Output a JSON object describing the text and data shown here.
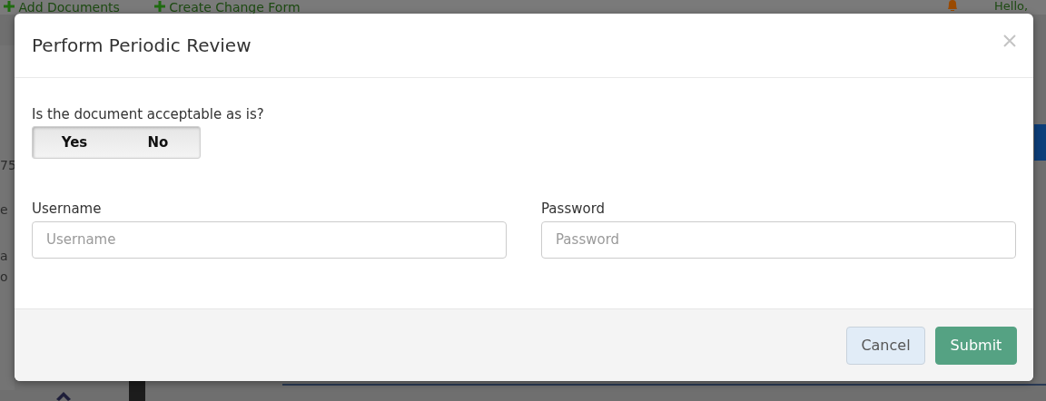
{
  "page_behind": {
    "top_links": [
      {
        "label": "Add Documents"
      },
      {
        "label": "Create Change Form"
      }
    ],
    "greeting": "Hello,",
    "side_fragments": [
      "75",
      "e",
      "a",
      "o"
    ]
  },
  "modal": {
    "title": "Perform Periodic Review",
    "question": "Is the document acceptable as is?",
    "toggle": [
      {
        "label": "Yes",
        "selected": false
      },
      {
        "label": "No",
        "selected": false
      }
    ],
    "fields": [
      {
        "label": "Username",
        "placeholder": "Username"
      },
      {
        "label": "Password",
        "placeholder": "Password"
      }
    ],
    "buttons": [
      {
        "label": "Cancel",
        "kind": "secondary"
      },
      {
        "label": "Submit",
        "kind": "primary"
      }
    ]
  }
}
